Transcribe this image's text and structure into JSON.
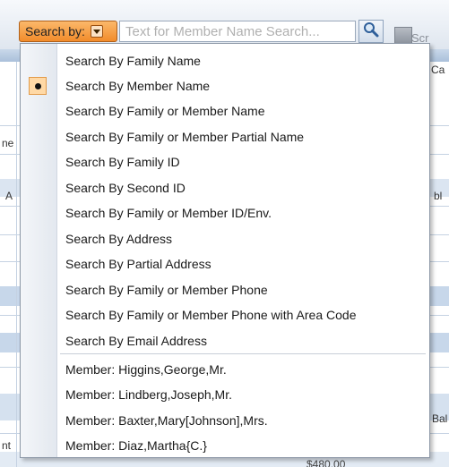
{
  "search": {
    "searchby_label": "Search by:",
    "placeholder": "Text for Member Name Search..."
  },
  "menu": {
    "options": [
      {
        "label": "Search By Family Name",
        "selected": false
      },
      {
        "label": "Search By Member Name",
        "selected": true
      },
      {
        "label": "Search By Family or Member Name",
        "selected": false
      },
      {
        "label": "Search By Family or Member Partial Name",
        "selected": false
      },
      {
        "label": "Search By Family ID",
        "selected": false
      },
      {
        "label": "Search By Second ID",
        "selected": false
      },
      {
        "label": "Search By Family or Member ID/Env.",
        "selected": false
      },
      {
        "label": "Search By Address",
        "selected": false
      },
      {
        "label": "Search By Partial Address",
        "selected": false
      },
      {
        "label": "Search By Family or Member Phone",
        "selected": false
      },
      {
        "label": "Search By Family or Member Phone with Area Code",
        "selected": false
      },
      {
        "label": "Search By Email Address",
        "selected": false
      }
    ],
    "recent": [
      {
        "label": "Member: Higgins,George,Mr."
      },
      {
        "label": "Member: Lindberg,Joseph,Mr."
      },
      {
        "label": "Member: Baxter,Mary[Johnson],Mrs."
      },
      {
        "label": "Member: Diaz,Martha{C.}"
      }
    ]
  },
  "background": {
    "fragments": [
      "Scr",
      "Ca",
      "ne",
      "A",
      "bl",
      "Bal",
      "nt",
      "$480.00"
    ]
  },
  "colors": {
    "accent_orange": "#f28c2b",
    "selected_highlight": "#ffd9a6",
    "grid_band": "#c7d7ea"
  }
}
